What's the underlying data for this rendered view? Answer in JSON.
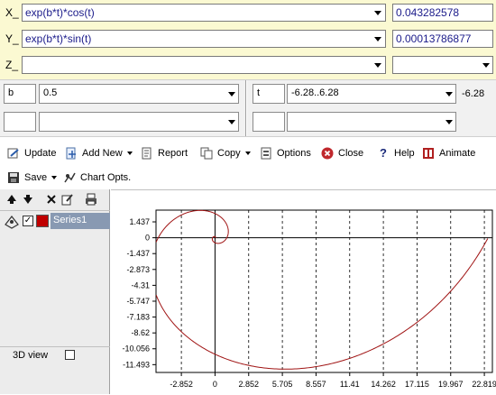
{
  "formulas": {
    "x": {
      "label": "X_",
      "expr": "exp(b*t)*cos(t)",
      "value": "0.043282578"
    },
    "y": {
      "label": "Y_",
      "expr": "exp(b*t)*sin(t)",
      "value": "0.00013786877"
    },
    "z": {
      "label": "Z_",
      "expr": "",
      "value": ""
    }
  },
  "params": {
    "left": {
      "name": "b",
      "value": "0.5"
    },
    "right": {
      "name": "t",
      "value": "-6.28..6.28",
      "trailing": "-6.28"
    }
  },
  "toolbar": {
    "update": "Update",
    "add_new": "Add New",
    "report": "Report",
    "copy": "Copy",
    "options": "Options",
    "close": "Close",
    "help": "Help",
    "animate": "Animate",
    "save": "Save",
    "chart_opts": "Chart Opts."
  },
  "series": {
    "name": "Series1",
    "checked": true,
    "color": "#c00000"
  },
  "view3d": {
    "label": "3D view",
    "checked": false
  },
  "chart_data": {
    "type": "line",
    "series": [
      {
        "name": "Series1",
        "color": "#a01414",
        "equation": "x=exp(0.5*t)*cos(t), y=exp(0.5*t)*sin(t), t in [-6.28, 6.28]"
      }
    ],
    "x_ticks": [
      "-2.852",
      "0",
      "2.852",
      "5.705",
      "8.557",
      "11.41",
      "14.262",
      "17.115",
      "19.967",
      "22.819"
    ],
    "y_ticks": [
      "1.437",
      "0",
      "-1.437",
      "-2.873",
      "-4.31",
      "-5.747",
      "-7.183",
      "-8.62",
      "-10.056",
      "-11.493"
    ],
    "xlim": [
      -5,
      23.5
    ],
    "ylim": [
      -12.2,
      2.5
    ],
    "grid_x": true,
    "grid_y": false
  }
}
